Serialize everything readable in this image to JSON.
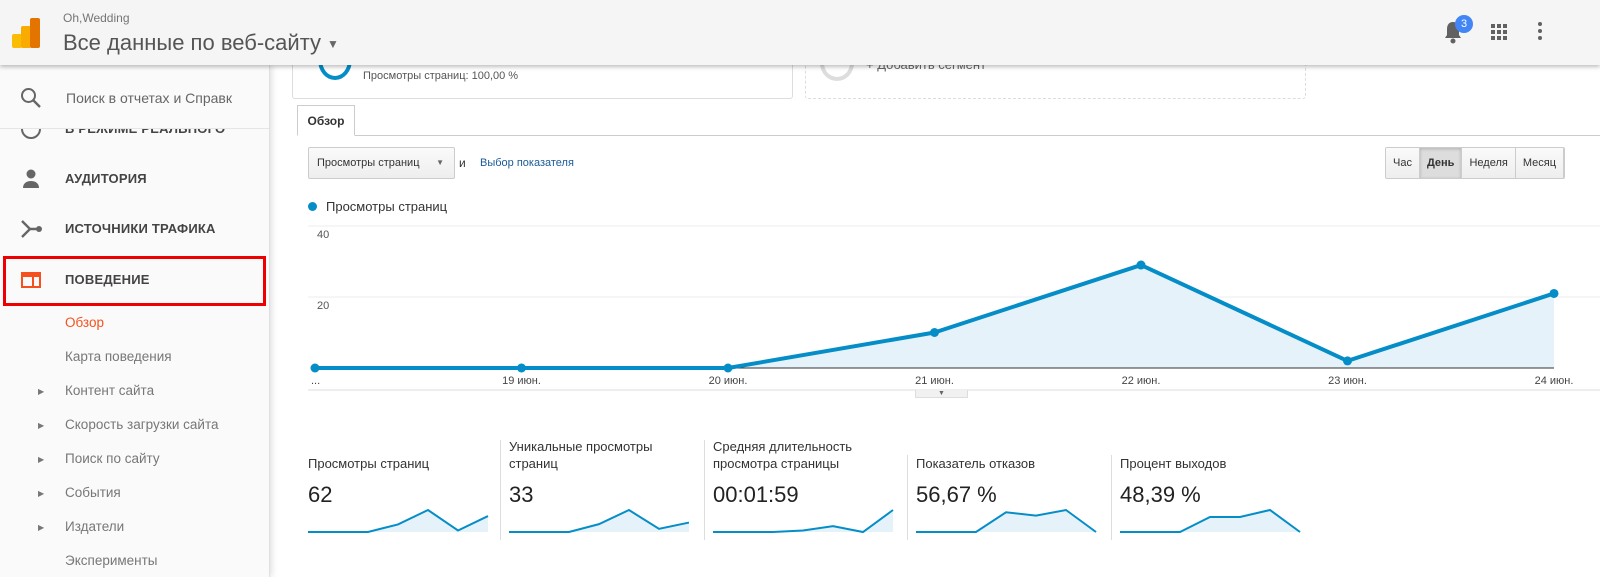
{
  "header": {
    "account": "Oh,Wedding",
    "property": "Все данные по веб-сайту",
    "notifications": "3"
  },
  "sidebar": {
    "search_placeholder": "Поиск в отчетах и Справк",
    "items": [
      {
        "label": "В РЕЖИМЕ РЕАЛЬНОГО",
        "icon": "clock-icon"
      },
      {
        "label": "АУДИТОРИЯ",
        "icon": "person-icon"
      },
      {
        "label": "ИСТОЧНИКИ ТРАФИКА",
        "icon": "fork-icon"
      },
      {
        "label": "ПОВЕДЕНИЕ",
        "icon": "window-icon",
        "selected": true
      }
    ],
    "subitems": [
      {
        "label": "Обзор",
        "active": true
      },
      {
        "label": "Карта поведения"
      },
      {
        "label": "Контент сайта",
        "expandable": true
      },
      {
        "label": "Скорость загрузки сайта",
        "expandable": true
      },
      {
        "label": "Поиск по сайту",
        "expandable": true
      },
      {
        "label": "События",
        "expandable": true
      },
      {
        "label": "Издатели",
        "expandable": true
      },
      {
        "label": "Эксперименты"
      }
    ]
  },
  "segments": {
    "current_stat": "Просмотры страниц: 100,00 %",
    "add_label": "+ Добавить сегмент"
  },
  "tabs": [
    {
      "label": "Обзор"
    }
  ],
  "controls": {
    "metric": "Просмотры страниц",
    "and": "и",
    "pick_metric": "Выбор показателя",
    "periods": [
      "Час",
      "День",
      "Неделя",
      "Месяц"
    ],
    "active_period": "День"
  },
  "chart_data": {
    "type": "area",
    "legend": "Просмотры страниц",
    "x": [
      "...",
      "19 июн.",
      "20 июн.",
      "21 июн.",
      "22 июн.",
      "23 июн.",
      "24 июн."
    ],
    "values": [
      0,
      0,
      0,
      10,
      29,
      2,
      21
    ],
    "yticks": [
      20,
      40
    ],
    "ylim": [
      0,
      40
    ],
    "color": "#058dc7",
    "grid": true
  },
  "scorecards": [
    {
      "label": "Просмотры страниц",
      "value": "62",
      "spark": [
        0,
        0,
        0,
        10,
        29,
        2,
        21
      ]
    },
    {
      "label": "Уникальные просмотры страниц",
      "value": "33",
      "spark": [
        0,
        0,
        0,
        5,
        14,
        2,
        6
      ]
    },
    {
      "label": "Средняя длительность просмотра страницы",
      "value": "00:01:59",
      "spark": [
        0,
        0,
        0,
        1,
        4,
        0,
        15
      ]
    },
    {
      "label": "Показатель отказов",
      "value": "56,67 %",
      "spark": [
        0,
        0,
        0,
        60,
        50,
        67,
        0
      ]
    },
    {
      "label": "Процент выходов",
      "value": "48,39 %",
      "spark": [
        0,
        0,
        0,
        28,
        28,
        41,
        0
      ]
    }
  ]
}
